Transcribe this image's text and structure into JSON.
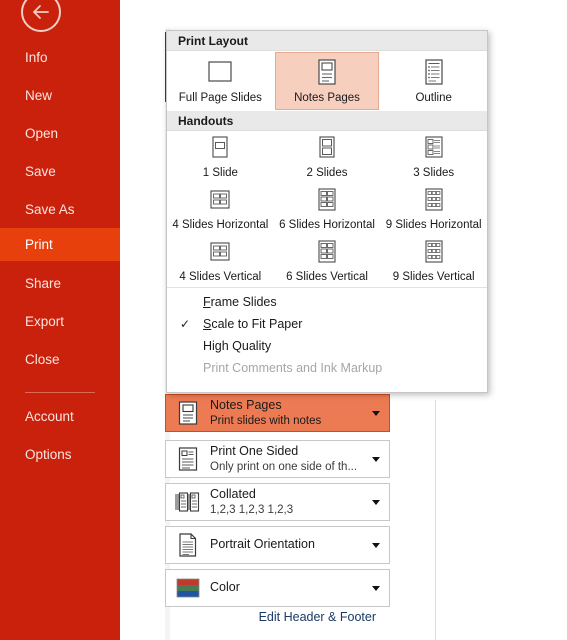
{
  "sidebar": {
    "back_icon": "back-arrow-icon",
    "items": [
      {
        "label": "Info",
        "active": false
      },
      {
        "label": "New",
        "active": false
      },
      {
        "label": "Open",
        "active": false
      },
      {
        "label": "Save",
        "active": false
      },
      {
        "label": "Save As",
        "active": false
      },
      {
        "label": "Print",
        "active": true
      },
      {
        "label": "Share",
        "active": false
      },
      {
        "label": "Export",
        "active": false
      },
      {
        "label": "Close",
        "active": false
      },
      {
        "label": "Account",
        "active": false
      },
      {
        "label": "Options",
        "active": false
      }
    ],
    "colors": {
      "background": "#c9210b",
      "active": "#e8400c",
      "text": "#fbe4df"
    }
  },
  "popup": {
    "print_layout": {
      "header": "Print Layout",
      "tiles": [
        {
          "label": "Full Page Slides",
          "icon": "full-page-slide-icon",
          "selected": false
        },
        {
          "label": "Notes Pages",
          "icon": "notes-page-icon",
          "selected": true
        },
        {
          "label": "Outline",
          "icon": "outline-icon",
          "selected": false
        }
      ]
    },
    "handouts": {
      "header": "Handouts",
      "tiles": [
        {
          "label": "1 Slide",
          "icon": "handout-1-icon"
        },
        {
          "label": "2 Slides",
          "icon": "handout-2-icon"
        },
        {
          "label": "3 Slides",
          "icon": "handout-3-icon"
        },
        {
          "label": "4 Slides Horizontal",
          "icon": "handout-4h-icon"
        },
        {
          "label": "6 Slides Horizontal",
          "icon": "handout-6h-icon"
        },
        {
          "label": "9 Slides Horizontal",
          "icon": "handout-9h-icon"
        },
        {
          "label": "4 Slides Vertical",
          "icon": "handout-4v-icon"
        },
        {
          "label": "6 Slides Vertical",
          "icon": "handout-6v-icon"
        },
        {
          "label": "9 Slides Vertical",
          "icon": "handout-9v-icon"
        }
      ]
    },
    "options": [
      {
        "label": "Frame Slides",
        "accel": "F",
        "checked": false,
        "disabled": false,
        "check_mark": ""
      },
      {
        "label": "Scale to Fit Paper",
        "accel": "S",
        "checked": true,
        "disabled": false,
        "check_mark": "✓"
      },
      {
        "label": "High Quality",
        "accel": "",
        "checked": false,
        "disabled": false,
        "check_mark": ""
      },
      {
        "label": "Print Comments and Ink Markup",
        "accel": "",
        "checked": false,
        "disabled": true,
        "check_mark": ""
      }
    ],
    "selection_color": "#f7cfbf"
  },
  "settings": {
    "buttons": [
      {
        "title": "Notes Pages",
        "subtitle": "Print slides with notes",
        "icon": "notes-page-icon",
        "highlighted": true
      },
      {
        "title": "Print One Sided",
        "subtitle": "Only print on one side of th...",
        "icon": "one-sided-icon",
        "highlighted": false
      },
      {
        "title": "Collated",
        "subtitle": "1,2,3   1,2,3   1,2,3",
        "icon": "collated-icon",
        "highlighted": false
      },
      {
        "title": "Portrait Orientation",
        "subtitle": "",
        "icon": "portrait-icon",
        "highlighted": false
      },
      {
        "title": "Color",
        "subtitle": "",
        "icon": "color-icon",
        "highlighted": false
      }
    ],
    "edit_header_footer": "Edit Header & Footer",
    "link_color": "#1b3a66",
    "highlight_color": "#ec7b54"
  }
}
